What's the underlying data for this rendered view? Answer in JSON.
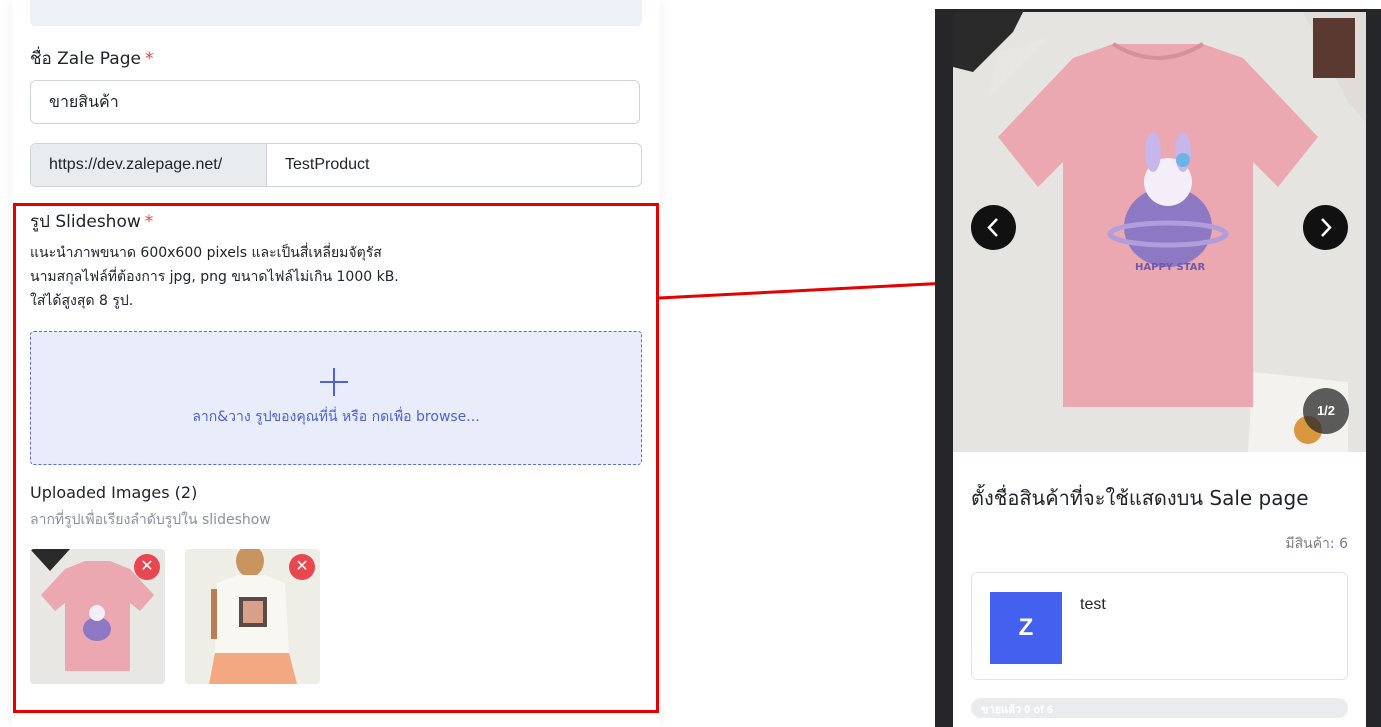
{
  "form": {
    "page_name_label": "ชื่อ Zale Page",
    "required_mark": "*",
    "page_name_value": "ขายสินค้า",
    "url_prefix": "https://dev.zalepage.net/",
    "url_slug": "TestProduct",
    "slideshow_label": "รูป Slideshow",
    "slideshow_hint": [
      "แนะนำภาพขนาด 600x600 pixels และเป็นสี่เหลี่ยมจัตุรัส",
      "นามสกุลไฟล์ที่ต้องการ jpg, png ขนาดไฟล์ไม่เกิน 1000 kB.",
      "ใส่ได้สูงสุด 8 รูป."
    ],
    "dropzone_text": "ลาก&วาง รูปของคุณที่นี่ หรือ กดเพื่อ browse...",
    "uploaded_title": "Uploaded Images (2)",
    "uploaded_subtitle": "ลากที่รูปเพื่อเรียงลำดับรูปใน slideshow",
    "remove_glyph": "✕"
  },
  "preview": {
    "slide_counter": "1/2",
    "tshirt_print_text": "HAPPY STAR",
    "product_title": "ตั้งชื่อสินค้าที่จะใช้แสดงบน Sale page",
    "stock_text": "มีสินค้า: 6",
    "variant_avatar_letter": "Z",
    "variant_name": "test",
    "sold_text": "ขายแล้ว 0 of 6"
  },
  "colors": {
    "highlight": "#e60000",
    "accent": "#4361ee",
    "danger": "#e8474f",
    "tshirt": "#eba8b0"
  },
  "icons": [
    "plus-icon",
    "close-icon",
    "chevron-left-icon",
    "chevron-right-icon",
    "arrow-annotation"
  ]
}
